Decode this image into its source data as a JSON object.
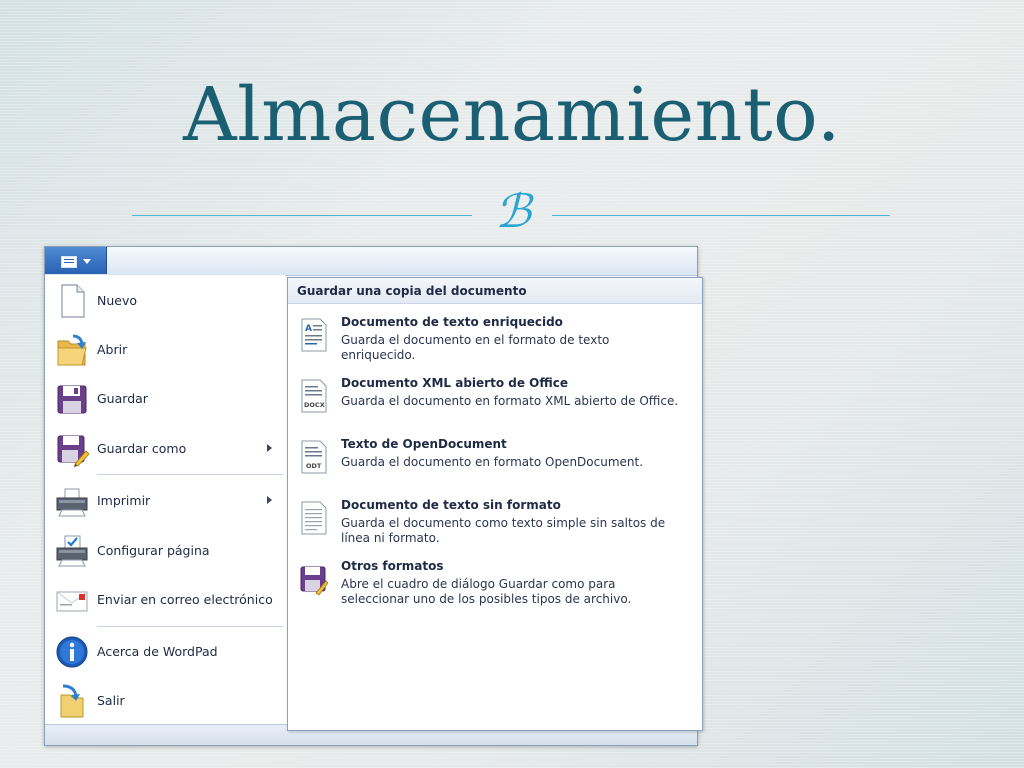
{
  "slide": {
    "title": "Almacenamiento.",
    "ornament": "ℬ"
  },
  "menu": {
    "items": [
      {
        "label": "Nuevo",
        "icon": "new-document-icon",
        "submenu": false
      },
      {
        "label": "Abrir",
        "icon": "open-folder-icon",
        "submenu": false
      },
      {
        "label": "Guardar",
        "icon": "save-floppy-icon",
        "submenu": false
      },
      {
        "label": "Guardar como",
        "icon": "save-as-icon",
        "submenu": true
      },
      {
        "label": "Imprimir",
        "icon": "printer-icon",
        "submenu": true
      },
      {
        "label": "Configurar página",
        "icon": "page-setup-icon",
        "submenu": false
      },
      {
        "label": "Enviar en correo electrónico",
        "icon": "email-envelope-icon",
        "submenu": false
      },
      {
        "label": "Acerca de WordPad",
        "icon": "info-icon",
        "submenu": false
      },
      {
        "label": "Salir",
        "icon": "exit-icon",
        "submenu": false
      }
    ]
  },
  "submenu": {
    "header": "Guardar una copia del documento",
    "options": [
      {
        "title": "Documento de texto enriquecido",
        "desc": "Guarda el documento en el formato de texto enriquecido.",
        "icon": "rtf-document-icon"
      },
      {
        "title": "Documento XML abierto de Office",
        "desc": "Guarda el documento en formato XML abierto de Office.",
        "icon": "docx-document-icon"
      },
      {
        "title": "Texto de OpenDocument",
        "desc": "Guarda el documento en formato OpenDocument.",
        "icon": "odt-document-icon"
      },
      {
        "title": "Documento de texto sin formato",
        "desc": "Guarda el documento como texto simple sin saltos de línea ni formato.",
        "icon": "plain-text-document-icon"
      },
      {
        "title": "Otros formatos",
        "desc": "Abre el cuadro de diálogo Guardar como para seleccionar uno de los posibles tipos de archivo.",
        "icon": "other-formats-icon"
      }
    ],
    "file_badges": {
      "docx": "DOCX",
      "odt": "ODT"
    }
  },
  "colors": {
    "title": "#1b5f73",
    "accent": "#2aa5cf",
    "app_button": "#2a62b4"
  }
}
